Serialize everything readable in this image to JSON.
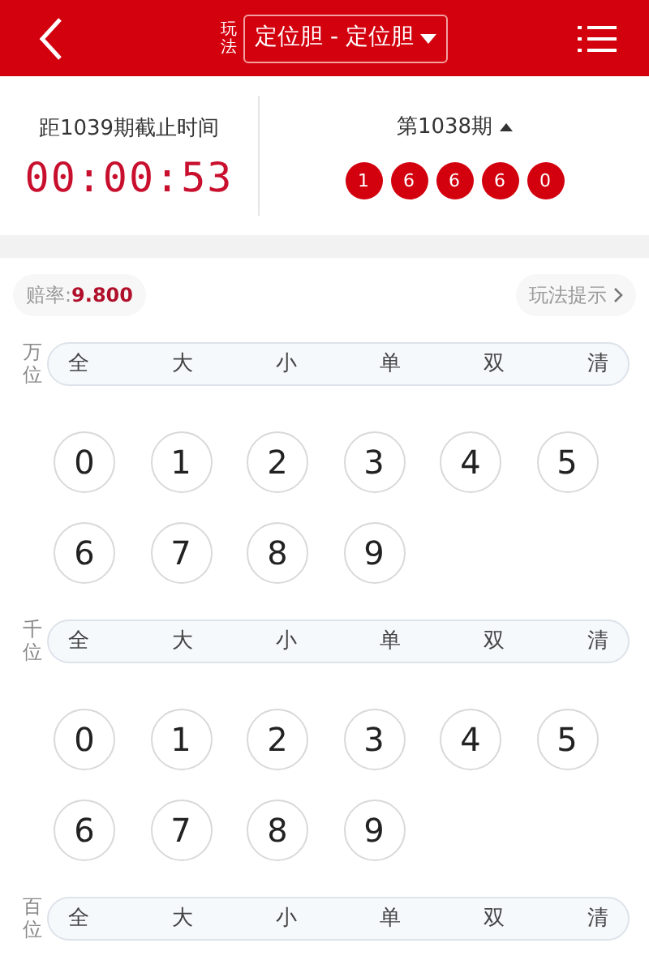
{
  "header": {
    "play_label": "玩法",
    "play_select": "定位胆 - 定位胆"
  },
  "draw_info": {
    "countdown_label": "距1039期截止时间",
    "countdown": "00:00:53",
    "last_issue": "第1038期",
    "results": [
      "1",
      "6",
      "6",
      "6",
      "0"
    ]
  },
  "odds": {
    "label": "赔率:",
    "value": "9.800",
    "hint": "玩法提示"
  },
  "positions": [
    {
      "label": "万位",
      "chips": [
        "全",
        "大",
        "小",
        "单",
        "双",
        "清"
      ],
      "balls": [
        "0",
        "1",
        "2",
        "3",
        "4",
        "5",
        "6",
        "7",
        "8",
        "9"
      ]
    },
    {
      "label": "千位",
      "chips": [
        "全",
        "大",
        "小",
        "单",
        "双",
        "清"
      ],
      "balls": [
        "0",
        "1",
        "2",
        "3",
        "4",
        "5",
        "6",
        "7",
        "8",
        "9"
      ]
    },
    {
      "label": "百位",
      "chips": [
        "全",
        "大",
        "小",
        "单",
        "双",
        "清"
      ]
    }
  ]
}
